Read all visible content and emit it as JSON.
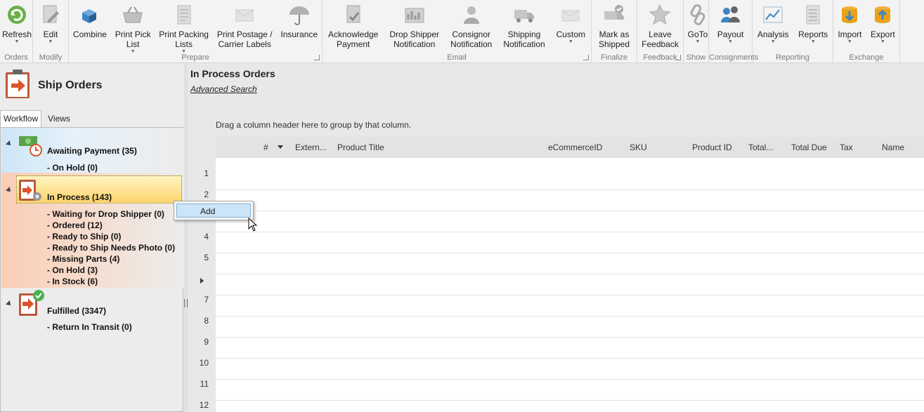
{
  "ribbon": {
    "groups": [
      {
        "name": "Orders",
        "buttons": [
          {
            "label": "Refresh",
            "icon": "refresh-icon",
            "caret": true
          }
        ]
      },
      {
        "name": "Modify",
        "buttons": [
          {
            "label": "Edit",
            "icon": "edit-icon",
            "caret": true
          }
        ]
      },
      {
        "name": "Prepare",
        "buttons": [
          {
            "label": "Combine",
            "icon": "combine-icon"
          },
          {
            "label": "Print Pick List",
            "line1": "Print Pick",
            "line2": "List",
            "icon": "basket-icon",
            "caret": true
          },
          {
            "label": "Print Packing Lists",
            "line1": "Print Packing",
            "line2": "Lists",
            "icon": "packing-list-icon",
            "caret": true
          },
          {
            "label": "Print Postage / Carrier Labels",
            "line1": "Print Postage /",
            "line2": "Carrier Labels",
            "icon": "postage-icon"
          },
          {
            "label": "Insurance",
            "icon": "umbrella-icon"
          }
        ]
      },
      {
        "name": "Email",
        "buttons": [
          {
            "label": "Acknowledge Payment",
            "line1": "Acknowledge",
            "line2": "Payment",
            "icon": "acknowledge-icon"
          },
          {
            "label": "Drop Shipper Notification",
            "line1": "Drop Shipper",
            "line2": "Notification",
            "icon": "drop-shipper-icon"
          },
          {
            "label": "Consignor Notification",
            "line1": "Consignor",
            "line2": "Notification",
            "icon": "consignor-icon"
          },
          {
            "label": "Shipping Notification",
            "line1": "Shipping",
            "line2": "Notification",
            "icon": "truck-icon"
          },
          {
            "label": "Custom",
            "icon": "envelope-icon",
            "caret": true
          }
        ]
      },
      {
        "name": "Finalize",
        "buttons": [
          {
            "label": "Mark as Shipped",
            "line1": "Mark as",
            "line2": "Shipped",
            "icon": "shipped-truck-icon"
          }
        ]
      },
      {
        "name": "Feedback",
        "buttons": [
          {
            "label": "Leave Feedback",
            "line1": "Leave",
            "line2": "Feedback",
            "icon": "star-icon"
          }
        ]
      },
      {
        "name": "Show",
        "buttons": [
          {
            "label": "GoTo",
            "icon": "link-icon",
            "caret": true
          }
        ]
      },
      {
        "name": "Consignments",
        "buttons": [
          {
            "label": "Payout",
            "icon": "payout-icon",
            "caret": true
          }
        ]
      },
      {
        "name": "Reporting",
        "buttons": [
          {
            "label": "Analysis",
            "icon": "chart-icon",
            "caret": true
          },
          {
            "label": "Reports",
            "icon": "report-icon",
            "caret": true
          }
        ]
      },
      {
        "name": "Exchange",
        "buttons": [
          {
            "label": "Import",
            "icon": "import-icon",
            "caret": true
          },
          {
            "label": "Export",
            "icon": "export-icon",
            "caret": true
          }
        ]
      }
    ]
  },
  "left": {
    "title": "Ship Orders",
    "tabs": [
      "Workflow",
      "Views"
    ],
    "sections": [
      {
        "name": "Awaiting Payment",
        "count": "35",
        "children": [
          {
            "name": "On Hold",
            "count": "0"
          }
        ]
      },
      {
        "name": "In Process",
        "count": "143",
        "children": [
          {
            "name": "Waiting for Drop Shipper",
            "count": "0"
          },
          {
            "name": "Ordered",
            "count": "12"
          },
          {
            "name": "Ready to Ship",
            "count": "0"
          },
          {
            "name": "Ready to Ship Needs Photo",
            "count": "0"
          },
          {
            "name": "Missing Parts",
            "count": "4"
          },
          {
            "name": "On Hold",
            "count": "3"
          },
          {
            "name": "In Stock",
            "count": "6"
          }
        ]
      },
      {
        "name": "Fulfilled",
        "count": "3347",
        "children": [
          {
            "name": "Return In Transit",
            "count": "0"
          }
        ]
      }
    ]
  },
  "main": {
    "title": "In Process Orders",
    "advanced_search": "Advanced Search",
    "group_hint": "Drag a column header here to group by that column.",
    "columns": [
      "#",
      "Extern...",
      "Product Title",
      "eCommerceID",
      "SKU",
      "Product ID",
      "Total...",
      "Total Due",
      "Tax",
      "Name"
    ],
    "row_numbers": [
      "1",
      "2",
      "3",
      "4",
      "5",
      "",
      "7",
      "8",
      "9",
      "10",
      "11",
      "12"
    ]
  },
  "context_menu": {
    "items": [
      "Add"
    ]
  }
}
